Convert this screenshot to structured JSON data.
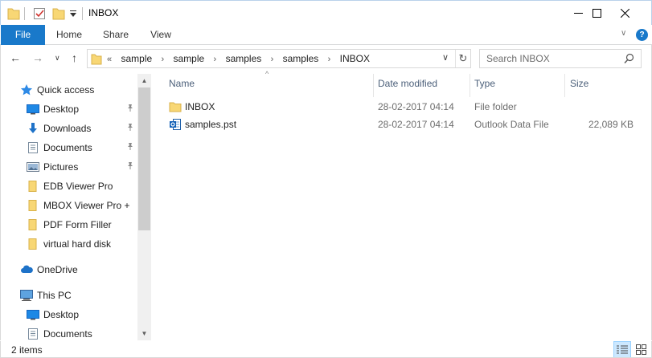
{
  "window": {
    "title": "INBOX",
    "minimize": "—",
    "maximize": "☐",
    "close": "✕"
  },
  "ribbon": {
    "tabs": [
      "File",
      "Home",
      "Share",
      "View"
    ],
    "expand_glyph": "∨",
    "help": "?"
  },
  "nav": {
    "back": "←",
    "forward": "→",
    "recent": "∨",
    "up": "↑",
    "overflow": "«",
    "breadcrumb": [
      "sample",
      "sample",
      "samples",
      "samples",
      "INBOX"
    ],
    "chevron": "›",
    "dropdown": "∨",
    "refresh": "↻"
  },
  "search": {
    "placeholder": "Search INBOX"
  },
  "sidebar": {
    "quick_access": {
      "label": "Quick access",
      "icon": "star-icon"
    },
    "items": [
      {
        "label": "Desktop",
        "icon": "desktop-icon",
        "pinned": true
      },
      {
        "label": "Downloads",
        "icon": "download-icon",
        "pinned": true
      },
      {
        "label": "Documents",
        "icon": "documents-icon",
        "pinned": true
      },
      {
        "label": "Pictures",
        "icon": "pictures-icon",
        "pinned": true
      },
      {
        "label": "EDB Viewer Pro",
        "icon": "folder-icon",
        "pinned": false
      },
      {
        "label": "MBOX Viewer Pro +",
        "icon": "folder-icon",
        "pinned": false
      },
      {
        "label": "PDF Form Filler",
        "icon": "folder-icon",
        "pinned": false
      },
      {
        "label": "virtual hard disk",
        "icon": "folder-icon",
        "pinned": false
      }
    ],
    "onedrive": {
      "label": "OneDrive",
      "icon": "cloud-icon"
    },
    "this_pc": {
      "label": "This PC",
      "icon": "computer-icon"
    },
    "pc_items": [
      {
        "label": "Desktop",
        "icon": "desktop-icon"
      },
      {
        "label": "Documents",
        "icon": "documents-icon"
      }
    ]
  },
  "list": {
    "columns": {
      "name": "Name",
      "date": "Date modified",
      "type": "Type",
      "size": "Size"
    },
    "sort_glyph": "^",
    "rows": [
      {
        "name": "INBOX",
        "date": "28-02-2017 04:14",
        "type": "File folder",
        "size": "",
        "icon": "folder-icon"
      },
      {
        "name": "samples.pst",
        "date": "28-02-2017 04:14",
        "type": "Outlook Data File",
        "size": "22,089 KB",
        "icon": "outlook-pst-icon"
      }
    ]
  },
  "status": {
    "count": "2 items"
  },
  "colors": {
    "accent": "#1979ca",
    "folder": "#f8d775",
    "header_text": "#4c607a"
  }
}
